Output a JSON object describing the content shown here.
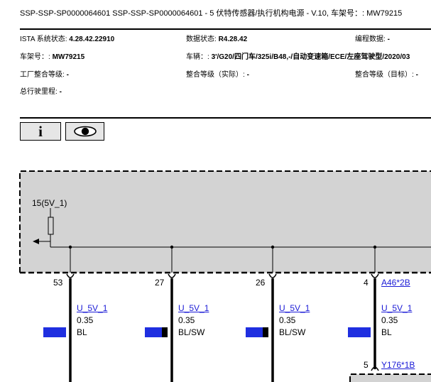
{
  "header": {
    "title": "SSP-SSP-SP0000064601 SSP-SSP-SP0000064601 - 5 伏特传感器/执行机构电源 - V.10, 车架号：: MW79215"
  },
  "info": {
    "ista_label": "ISTA 系统状态: ",
    "ista_value": "4.28.42.22910",
    "data_label": "数据状态: ",
    "data_value": "R4.28.42",
    "prog_label": "编程数据: ",
    "prog_value": "-",
    "vin_label": "车架号：: ",
    "vin_value": "MW79215",
    "vehicle_label": "车辆：: ",
    "vehicle_value": "3'/G20/四门车/325i/B48,-/自动变速箱/ECE/左座驾驶型/2020/03",
    "factory_label": "工厂整合等级: ",
    "factory_value": "-",
    "actual_label": "整合等级（实际）: ",
    "actual_value": "-",
    "target_label": "整合等级（目标）: ",
    "target_value": "-",
    "mileage_label": "总行驶里程: ",
    "mileage_value": "-"
  },
  "toolbar": {
    "info_glyph": "i",
    "view_icon": "eye-icon"
  },
  "diagram": {
    "supply_label": "15(5V_1)",
    "wires": [
      {
        "pin": "53",
        "signal": "U_5V_1",
        "gauge": "0.35",
        "color": "BL",
        "swatch": [
          "#1f2fe0"
        ]
      },
      {
        "pin": "27",
        "signal": "U_5V_1",
        "gauge": "0.35",
        "color": "BL/SW",
        "swatch": [
          "#1f2fe0",
          "#000000"
        ]
      },
      {
        "pin": "26",
        "signal": "U_5V_1",
        "gauge": "0.35",
        "color": "BL/SW",
        "swatch": [
          "#1f2fe0",
          "#000000"
        ]
      },
      {
        "pin": "4",
        "signal": "U_5V_1",
        "gauge": "0.35",
        "color": "BL",
        "swatch": [
          "#1f2fe0"
        ]
      }
    ],
    "connector_top": "A46*2B",
    "connector_bottom_pin": "5",
    "connector_bottom": "Y176*1B",
    "colors": {
      "module_fill": "#d3d3d3",
      "link": "#1a1ad6",
      "wire_blue": "#1f2fe0"
    }
  }
}
